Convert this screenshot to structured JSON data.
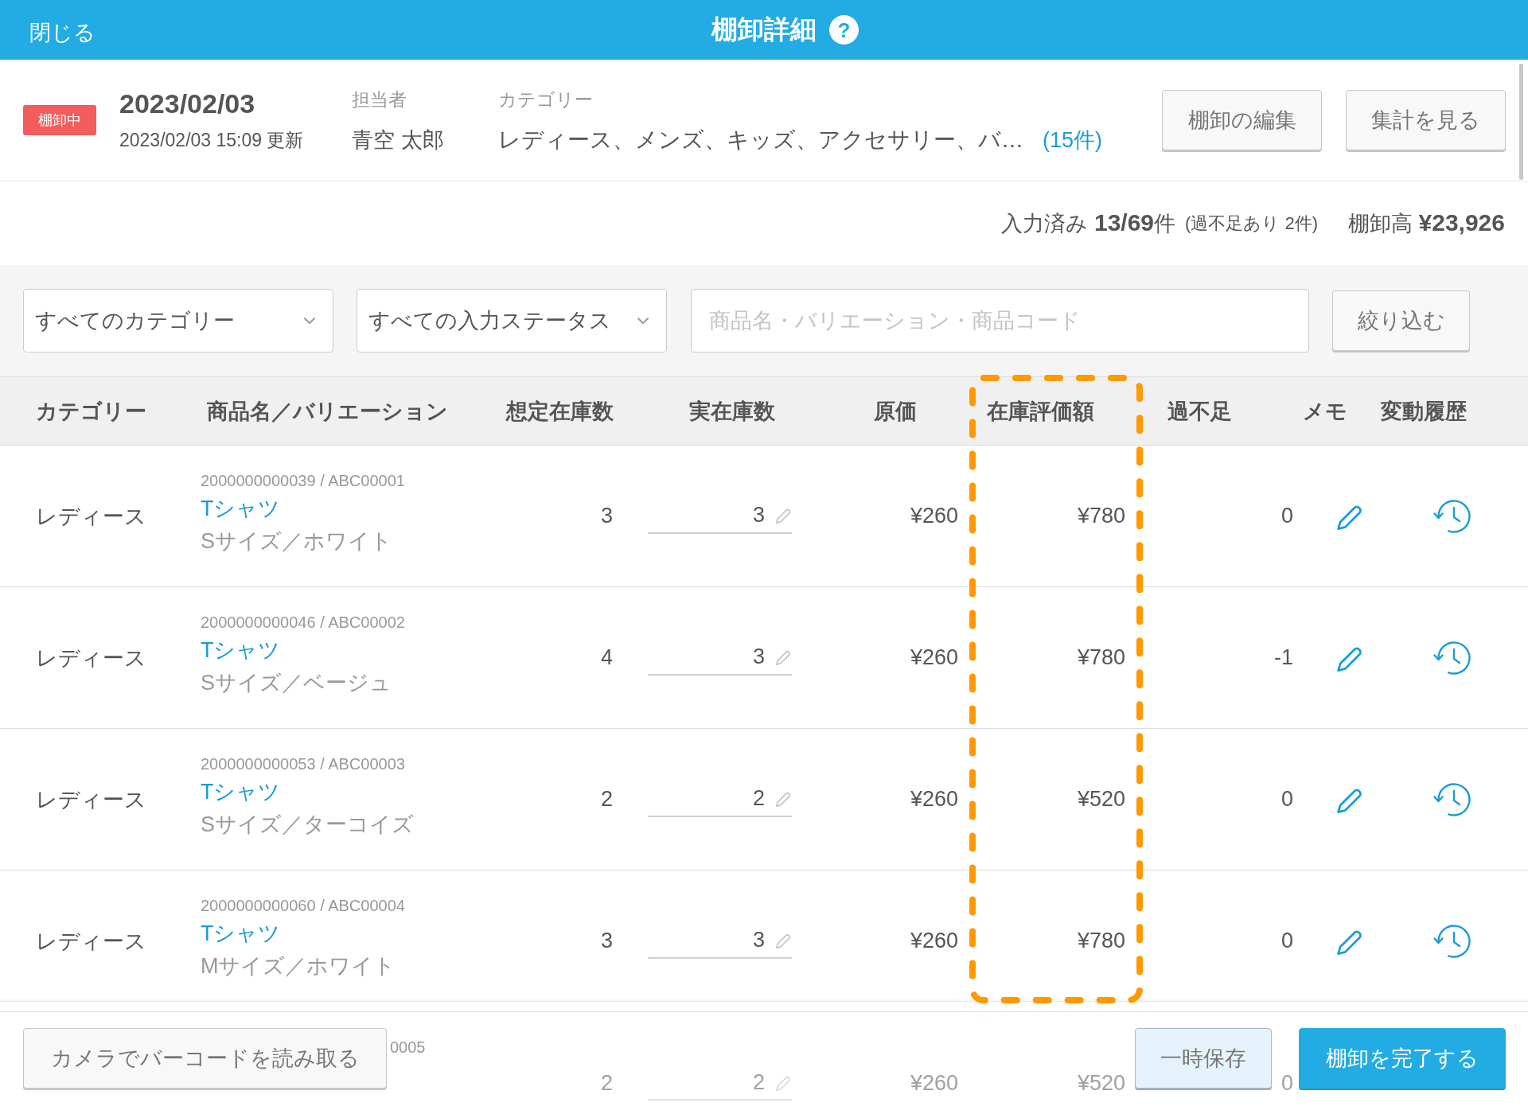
{
  "top_bar": {
    "close": "閉じる",
    "title": "棚卸詳細",
    "help": "?"
  },
  "info": {
    "status_badge": "棚卸中",
    "date": "2023/02/03",
    "updated": "2023/02/03 15:09 更新",
    "assignee_label": "担当者",
    "assignee": "青空 太郎",
    "category_label": "カテゴリー",
    "categories": "レディース、メンズ、キッズ、アクセサリー、バ…",
    "category_count": "(15件)",
    "buttons": [
      "棚卸の編集",
      "集計を見る"
    ]
  },
  "summary": {
    "entered": "入力済み **13/69**件",
    "shortage_note": "(過不足あり 2件)",
    "total": "棚卸高 **¥23,926**"
  },
  "filters": {
    "category_select": "すべてのカテゴリー",
    "status_select": "すべての入力ステータス",
    "search": {
      "placeholder": "商品名・バリエーション・商品コード"
    },
    "filter_button": "絞り込む"
  },
  "table": {
    "columns": [
      {
        "label": "カテゴリー",
        "highlighted": false
      },
      {
        "label": "商品名／バリエーション",
        "highlighted": false
      },
      {
        "label": "想定在庫数",
        "highlighted": false
      },
      {
        "label": "実在庫数",
        "highlighted": false
      },
      {
        "label": "原価",
        "highlighted": false
      },
      {
        "label": "在庫評価額",
        "highlighted": true
      },
      {
        "label": "過不足",
        "highlighted": false
      },
      {
        "label": "メモ",
        "highlighted": false
      },
      {
        "label": "変動履歴",
        "highlighted": false
      }
    ],
    "rows": [
      {
        "kind": "full",
        "category": "レディース",
        "code": "2000000000039 / ABC00001",
        "name": "Tシャツ",
        "variation": "Sサイズ／ホワイト",
        "expected": "3",
        "actual": "3",
        "cost": "¥260",
        "value": "¥780",
        "difference": "0"
      },
      {
        "kind": "full",
        "category": "レディース",
        "code": "2000000000046 / ABC00002",
        "name": "Tシャツ",
        "variation": "Sサイズ／ベージュ",
        "expected": "4",
        "actual": "3",
        "cost": "¥260",
        "value": "¥780",
        "difference": "-1"
      },
      {
        "kind": "full",
        "category": "レディース",
        "code": "2000000000053 / ABC00003",
        "name": "Tシャツ",
        "variation": "Sサイズ／ターコイズ",
        "expected": "2",
        "actual": "2",
        "cost": "¥260",
        "value": "¥520",
        "difference": "0"
      },
      {
        "kind": "full",
        "category": "レディース",
        "code": "2000000000060 / ABC00004",
        "name": "Tシャツ",
        "variation": "Mサイズ／ホワイト",
        "expected": "3",
        "actual": "3",
        "cost": "¥260",
        "value": "¥780",
        "difference": "0"
      },
      {
        "kind": "partial",
        "code": "0005",
        "expected": "2",
        "actual": "2",
        "cost": "¥260",
        "value": "¥520",
        "difference": "0"
      }
    ]
  },
  "footer": {
    "camera_button": "カメラでバーコードを読み取る",
    "save_button": "一時保存",
    "complete_button": "棚卸を完了する"
  }
}
